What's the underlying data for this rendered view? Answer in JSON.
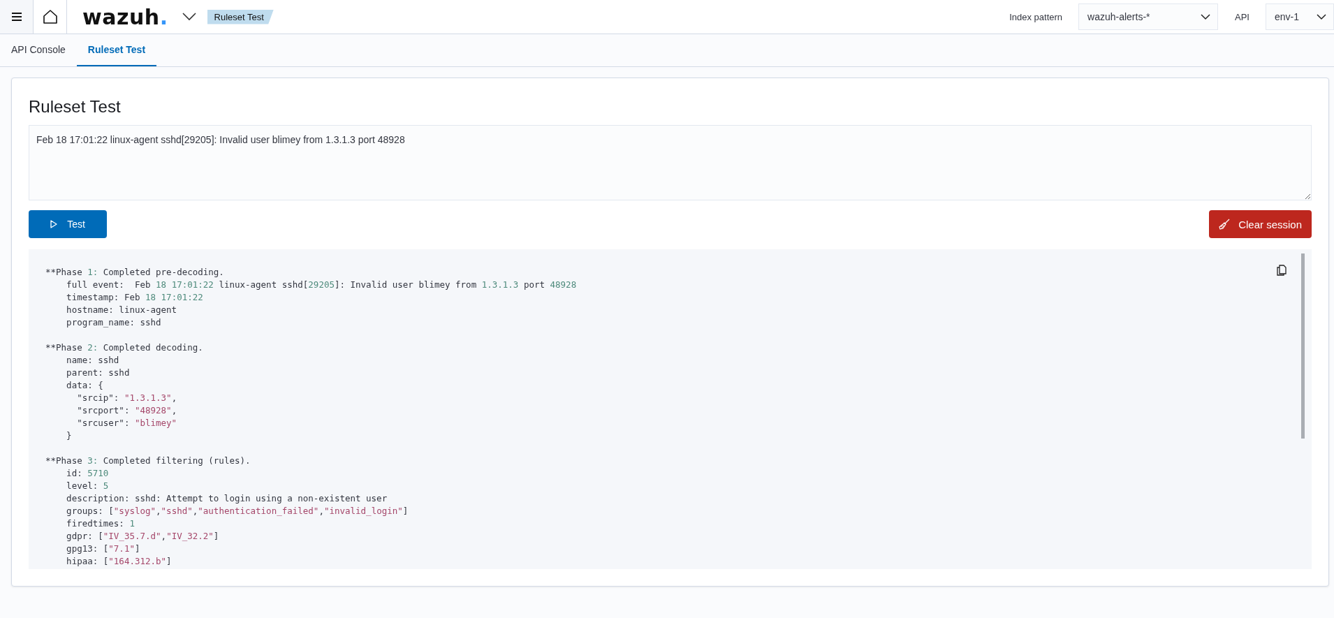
{
  "header": {
    "logo": "wazuh",
    "logo_dot": ".",
    "breadcrumb": "Ruleset Test",
    "index_pattern_label": "Index pattern",
    "index_pattern": "wazuh-alerts-*",
    "api_label": "API",
    "api": "env-1"
  },
  "tabs": [
    {
      "label": "API Console",
      "selected": false
    },
    {
      "label": "Ruleset Test",
      "selected": true
    }
  ],
  "panel": {
    "title": "Ruleset Test",
    "log_input": "Feb 18 17:01:22 linux-agent sshd[29205]: Invalid user blimey from 1.3.1.3 port 48928",
    "test_button": "Test",
    "clear_button": "Clear session"
  },
  "output_sections": [
    [
      "**Phase 1: Completed pre-decoding.",
      "    full event:  Feb 18 17:01:22 linux-agent sshd[29205]: Invalid user blimey from 1.3.1.3 port 48928",
      "    timestamp: Feb 18 17:01:22",
      "    hostname: linux-agent",
      "    program_name: sshd"
    ],
    [
      "**Phase 2: Completed decoding.",
      "    name: sshd",
      "    parent: sshd",
      "    data: {",
      "      \"srcip\": \"1.3.1.3\",",
      "      \"srcport\": \"48928\",",
      "      \"srcuser\": \"blimey\"",
      "    }"
    ],
    [
      "**Phase 3: Completed filtering (rules).",
      "    id: 5710",
      "    level: 5",
      "    description: sshd: Attempt to login using a non-existent user",
      "    groups: [\"syslog\",\"sshd\",\"authentication_failed\",\"invalid_login\"]",
      "    firedtimes: 1",
      "    gdpr: [\"IV_35.7.d\",\"IV_32.2\"]",
      "    gpg13: [\"7.1\"]",
      "    hipaa: [\"164.312.b\"]"
    ]
  ]
}
